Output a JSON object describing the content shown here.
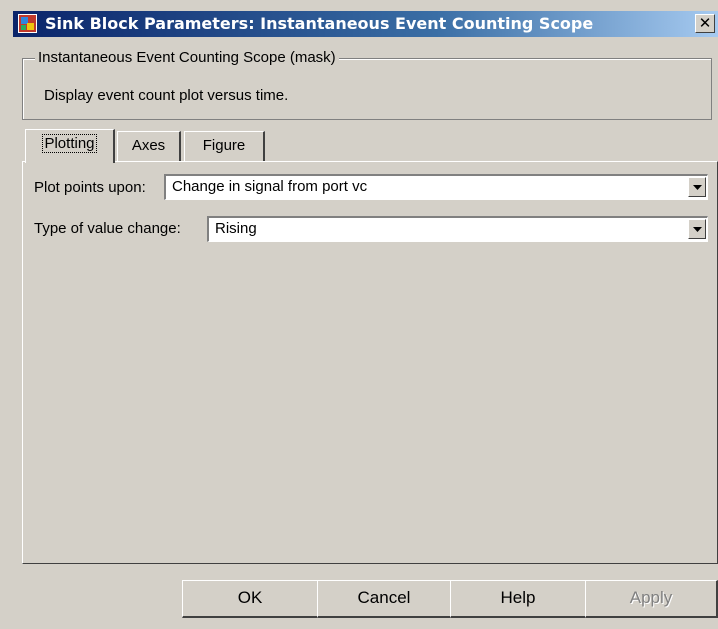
{
  "window": {
    "title": "Sink Block Parameters: Instantaneous Event Counting Scope",
    "close_glyph": "✕"
  },
  "mask": {
    "group_title": "Instantaneous Event Counting Scope (mask)",
    "description": "Display event count plot versus time."
  },
  "tabs": [
    {
      "label": "Plotting",
      "active": true
    },
    {
      "label": "Axes",
      "active": false
    },
    {
      "label": "Figure",
      "active": false
    }
  ],
  "fields": {
    "plot_points_upon": {
      "label": "Plot points upon:",
      "value": "Change in signal from port vc"
    },
    "type_of_value_change": {
      "label": "Type of value change:",
      "value": "Rising"
    }
  },
  "buttons": {
    "ok": "OK",
    "cancel": "Cancel",
    "help": "Help",
    "apply": "Apply"
  },
  "icons": {
    "app": "simulink-block-icon",
    "close": "close-icon",
    "dropdown": "dropdown-arrow-icon"
  },
  "colors": {
    "dialog_bg": "#d4d0c8",
    "title_start": "#0a246a",
    "title_end": "#a6caf0",
    "disabled_text": "#808080"
  }
}
